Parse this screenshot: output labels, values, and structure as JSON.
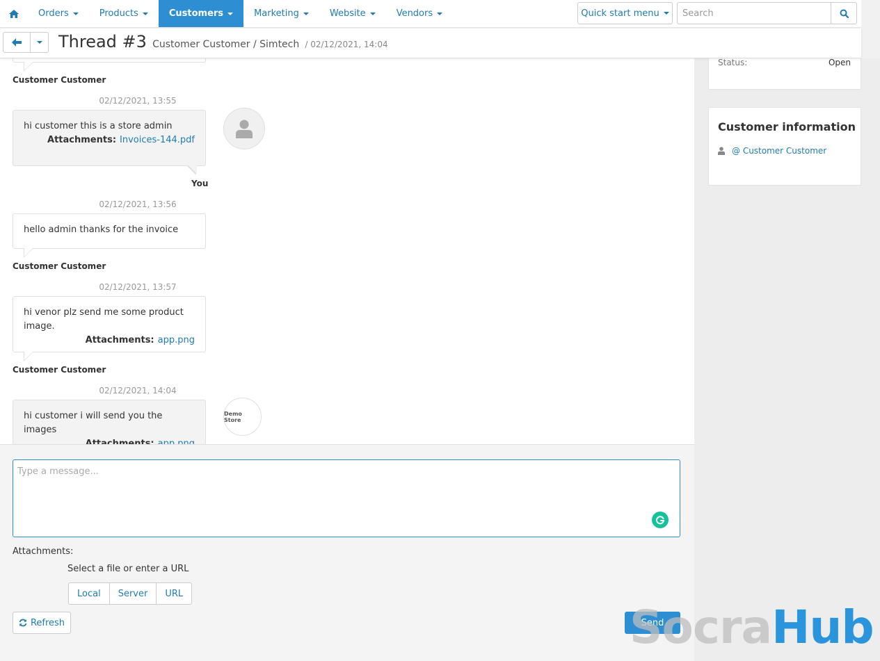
{
  "nav": {
    "items": [
      {
        "label": "Orders"
      },
      {
        "label": "Products"
      },
      {
        "label": "Customers"
      },
      {
        "label": "Marketing"
      },
      {
        "label": "Website"
      },
      {
        "label": "Vendors"
      }
    ],
    "active": "Customers",
    "quick_start_label": "Quick start menu",
    "search_placeholder": "Search"
  },
  "header": {
    "title": "Thread #3",
    "subtitle": "Customer Customer / Simtech",
    "date": "/ 02/12/2021, 14:04"
  },
  "messages": [
    {
      "author": "Customer Customer"
    },
    {
      "timestamp": "02/12/2021, 13:55",
      "text": "hi customer this is a store admin",
      "attachments_label": "Attachments:",
      "attachment": "Invoices-144.pdf",
      "author": "You"
    },
    {
      "timestamp": "02/12/2021, 13:56",
      "text": "hello admin thanks for the invoice",
      "author": "Customer Customer"
    },
    {
      "timestamp": "02/12/2021, 13:57",
      "text": "hi venor plz send me some product image.",
      "attachments_label": "Attachments:",
      "attachment": "app.png",
      "author": "Customer Customer"
    },
    {
      "timestamp": "02/12/2021, 14:04",
      "text": "hi customer i will send you the images",
      "attachments_label": "Attachments:",
      "attachment": "app.png",
      "avatar_text": "Demo Store"
    }
  ],
  "reply": {
    "placeholder": "Type a message...",
    "attachments_label": "Attachments:",
    "select_label": "Select a file or enter a URL",
    "file_buttons": [
      "Local",
      "Server",
      "URL"
    ],
    "refresh_label": "Refresh",
    "send_label": "Send"
  },
  "sidebar": {
    "status_label": "Status:",
    "status_value": "Open",
    "customer_title": "Customer information",
    "customer_link": "@ Customer Customer"
  },
  "watermark": {
    "part1": "Socra",
    "part2": "Hub"
  },
  "colors": {
    "accent": "#2d8ed1",
    "link": "#1f7cb3",
    "grammarly": "#15c39a"
  }
}
